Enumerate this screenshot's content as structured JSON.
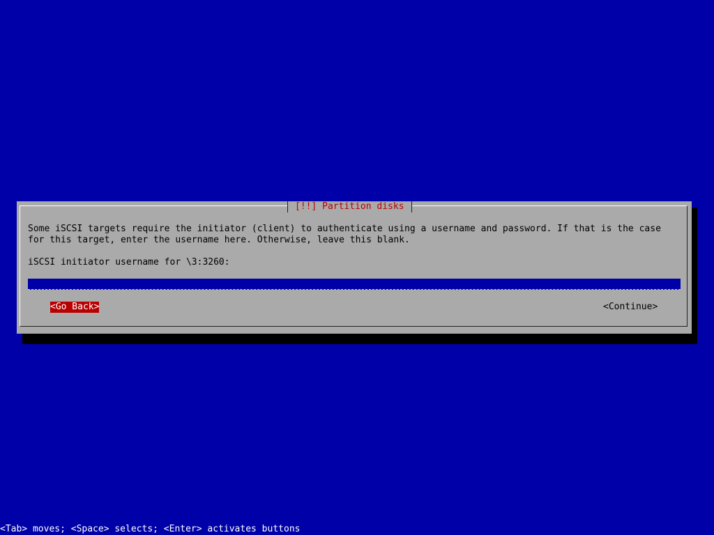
{
  "dialog": {
    "title": "[!!] Partition disks",
    "message": "Some iSCSI targets require the initiator (client) to authenticate using a username and password. If that is the case\nfor this target, enter the username here. Otherwise, leave this blank.",
    "prompt": "iSCSI initiator username for \\3:3260:",
    "input_value": "",
    "buttons": {
      "back": "<Go Back>",
      "continue": "<Continue>"
    }
  },
  "status_line": "<Tab> moves; <Space> selects; <Enter> activates buttons",
  "colors": {
    "background": "#0000a8",
    "dialog": "#aaaaaa",
    "title_text": "#b80000",
    "focused_button": "#b80000",
    "input_bg": "#0000a8"
  }
}
